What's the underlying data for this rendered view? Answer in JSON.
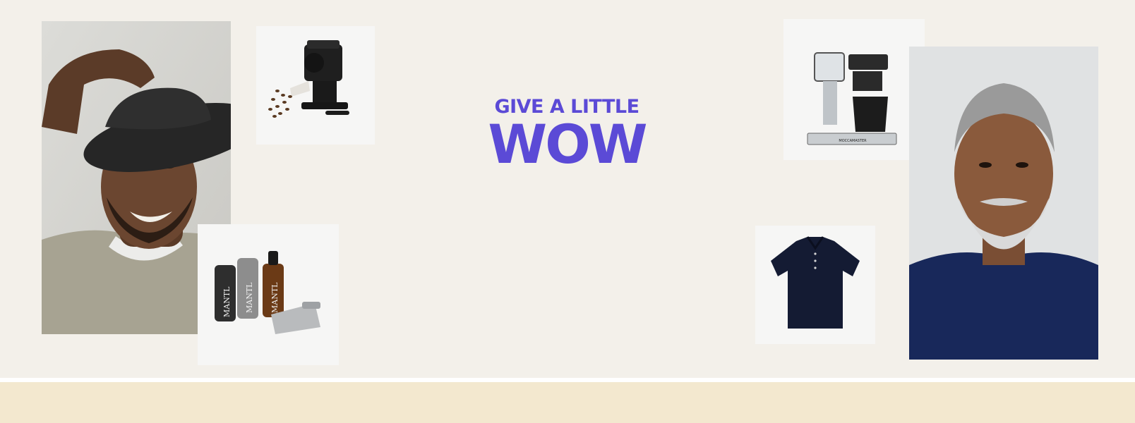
{
  "hero": {
    "headline_line1": "GIVE A LITTLE",
    "headline_line2": "WOW",
    "accent_color": "#5b4ad6",
    "background_color": "#f3f0ea",
    "footer_band_color": "#f3e8cf",
    "images": [
      {
        "name": "portrait-man-hat",
        "kind": "photo"
      },
      {
        "name": "coffee-grinder",
        "kind": "product"
      },
      {
        "name": "grooming-set",
        "kind": "product"
      },
      {
        "name": "coffee-maker",
        "kind": "product"
      },
      {
        "name": "polo-shirt",
        "kind": "product"
      },
      {
        "name": "portrait-man-beard",
        "kind": "photo"
      }
    ],
    "grooming_bottle_text": "MANTL",
    "coffee_maker_brand": "MOCCAMASTER"
  }
}
